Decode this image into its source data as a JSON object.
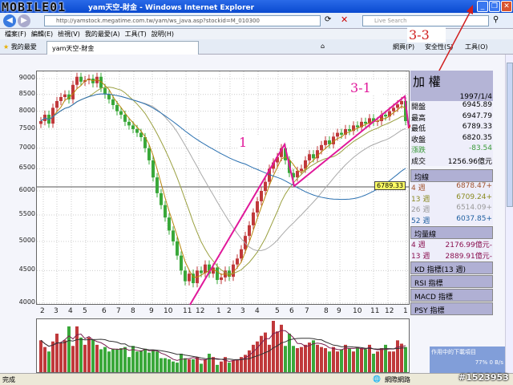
{
  "window": {
    "title": "yam天空-財金 - Windows Internet Explorer",
    "logo": "MOBILE01"
  },
  "address": {
    "url": "http://yamstock.megatime.com.tw/yam/ws_java.asp?stockid=M_010300",
    "search_placeholder": "Live Search"
  },
  "menu": [
    "檔案(F)",
    "編輯(E)",
    "檢視(V)",
    "我的最愛(A)",
    "工具(T)",
    "說明(H)"
  ],
  "favorites_label": "我的最愛",
  "tab": {
    "label": "yam天空-財金"
  },
  "toolbar": [
    "網頁(P)",
    "安全性(S)",
    "工具(O)"
  ],
  "side": {
    "title": "加 權",
    "date": "1997/1/4",
    "quotes": [
      {
        "label": "開盤",
        "value": "6945.89"
      },
      {
        "label": "最高",
        "value": "6947.79"
      },
      {
        "label": "最低",
        "value": "6789.33"
      },
      {
        "label": "收盤",
        "value": "6820.35"
      },
      {
        "label": "漲跌",
        "value": "-83.54"
      },
      {
        "label": "成交",
        "value": "1256.96億元"
      }
    ],
    "ma_title": "均線",
    "ma": [
      {
        "label": "4 週",
        "value": "6878.47+",
        "color": "#a0522d"
      },
      {
        "label": "13 週",
        "value": "6709.24+",
        "color": "#8a8a20"
      },
      {
        "label": "26 週",
        "value": "6514.09+",
        "color": "#999999"
      },
      {
        "label": "52 週",
        "value": "6037.85+",
        "color": "#1f5fa0"
      }
    ],
    "vma_title": "均量線",
    "vma": [
      {
        "label": "4 週",
        "value": "2176.99億元-"
      },
      {
        "label": "13 週",
        "value": "2889.91億元-"
      }
    ],
    "indicators": [
      "KD 指標(13 週)",
      "RSI 指標",
      "MACD 指標",
      "PSY 指標"
    ]
  },
  "status": {
    "text": "完成",
    "zone": "網際網路"
  },
  "download": {
    "title": "作用中的下載項目",
    "rate": "77% 0 B/s"
  },
  "watermark": "#1523953",
  "annotations": {
    "a1": "1",
    "a31": "3-1",
    "a33": "3-3"
  },
  "chart_data": {
    "type": "candlestick",
    "yscale": "log",
    "ylim": [
      4000,
      9000
    ],
    "yticks": [
      "9000",
      "8500",
      "8000",
      "7500",
      "7000",
      "6500",
      "6000",
      "5500",
      "5000",
      "4500",
      "4000"
    ],
    "xticks": [
      "2",
      "3",
      "4",
      "5",
      "6",
      "7",
      "8",
      "9",
      "10",
      "11",
      "12",
      "1",
      "2",
      "3",
      "4",
      "5",
      "6",
      "7",
      "8",
      "9",
      "10",
      "11",
      "12",
      "1"
    ],
    "last_price": "6789.33",
    "colors": {
      "up": "#c0393b",
      "down": "#3aa83a",
      "ma4": "#b8860b",
      "ma13": "#9aa040",
      "ma26": "#aaaaaa",
      "ma52": "#2a70b0"
    },
    "close": [
      7720,
      7900,
      7650,
      8100,
      8300,
      8420,
      8500,
      8350,
      8800,
      9060,
      8900,
      8950,
      9000,
      8850,
      9060,
      8700,
      8500,
      8350,
      8180,
      8000,
      7900,
      7700,
      7600,
      7500,
      7400,
      7285,
      7000,
      6700,
      6300,
      5950,
      5700,
      5450,
      5200,
      5000,
      4750,
      4500,
      4330,
      4450,
      4300,
      4500,
      4460,
      4600,
      4450,
      4550,
      4350,
      4390,
      4500,
      4400,
      4600,
      4700,
      4860,
      5100,
      5300,
      5550,
      5780,
      6000,
      6200,
      6500,
      6650,
      6780,
      7000,
      6700,
      6400,
      6300,
      6450,
      6500,
      6700,
      6850,
      6750,
      6950,
      7080,
      7200,
      7100,
      7300,
      7400,
      7350,
      7500,
      7450,
      7600,
      7550,
      7700,
      7650,
      7800,
      7700,
      7720,
      7900,
      7850,
      8000,
      8100,
      8200,
      8300,
      7720
    ],
    "volume": [
      60,
      48,
      40,
      58,
      72,
      55,
      60,
      85,
      50,
      85,
      65,
      52,
      65,
      62,
      52,
      44,
      48,
      40,
      45,
      44,
      46,
      48,
      30,
      50,
      40,
      42,
      45,
      38,
      42,
      40,
      28,
      28,
      26,
      22,
      20,
      36,
      28,
      26,
      26,
      30,
      18,
      26,
      36,
      30,
      16,
      22,
      30,
      20,
      24,
      26,
      30,
      34,
      42,
      52,
      58,
      68,
      74,
      52,
      95,
      76,
      88,
      50,
      72,
      50,
      46,
      48,
      52,
      56,
      60,
      52,
      48,
      46,
      40,
      48,
      40,
      44,
      52,
      46,
      40,
      48,
      46,
      44,
      52,
      36,
      40,
      46,
      52,
      40,
      40,
      60,
      54,
      48
    ]
  }
}
